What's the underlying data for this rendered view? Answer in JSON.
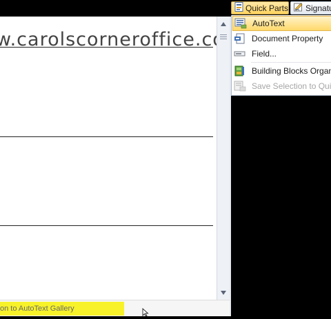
{
  "ribbon": {
    "quick_parts_label": "Quick Parts",
    "signature_label": "Signatur"
  },
  "document": {
    "watermark_text": "w.carolscorneroffice.com"
  },
  "status_bar": {
    "tip_text": "on to AutoText Gallery"
  },
  "quick_parts_menu": {
    "items": [
      {
        "label": "AutoText",
        "icon": "autotext-icon",
        "highlighted": true,
        "enabled": true
      },
      {
        "label": "Document Property",
        "icon": "document-property-icon",
        "highlighted": false,
        "enabled": true
      },
      {
        "label": "Field...",
        "icon": "field-icon",
        "highlighted": false,
        "enabled": true
      },
      {
        "label": "Building Blocks Organiz",
        "icon": "building-blocks-icon",
        "highlighted": false,
        "enabled": true
      },
      {
        "label": "Save Selection to Quick",
        "icon": "save-selection-icon",
        "highlighted": false,
        "enabled": false
      }
    ]
  },
  "colors": {
    "highlight": "#ffd96b",
    "status_tip": "#f7f229",
    "background": "#000000"
  }
}
